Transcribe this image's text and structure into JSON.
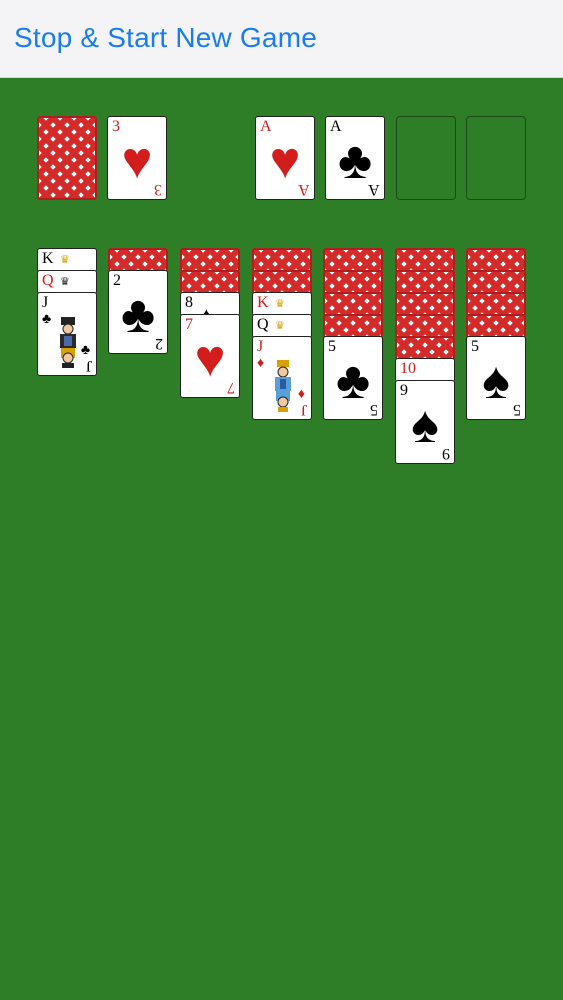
{
  "header": {
    "button_label": "Stop & Start New Game"
  },
  "colors": {
    "felt": "#2e7d27",
    "header_bg": "#f4f4f6",
    "link": "#1a7cf0",
    "red_suit": "#d31c1c",
    "card_back": "#d42a2a"
  },
  "stock": {
    "label": "card-back"
  },
  "waste": {
    "rank": "3",
    "suit": "hearts",
    "suit_glyph": "♥"
  },
  "foundations": [
    {
      "rank": "A",
      "suit": "hearts",
      "suit_glyph": "♥"
    },
    {
      "rank": "A",
      "suit": "clubs",
      "suit_glyph": "♣"
    },
    {
      "empty": true
    },
    {
      "empty": true
    }
  ],
  "tableau": {
    "col1": {
      "k": "K",
      "q": "Q",
      "j": "J",
      "j_suit": "♣"
    },
    "col2": {
      "rank": "2",
      "suit_glyph": "♣"
    },
    "col3": {
      "under": "8",
      "rank": "7",
      "suit_glyph": "♥"
    },
    "col4": {
      "k": "K",
      "q": "Q",
      "j": "J",
      "j_suit": "♦"
    },
    "col5": {
      "rank": "5",
      "suit_glyph": "♣"
    },
    "col6": {
      "under": "10",
      "rank": "9",
      "suit_glyph": "♠"
    },
    "col7": {
      "rank": "5",
      "suit_glyph": "♠"
    }
  }
}
